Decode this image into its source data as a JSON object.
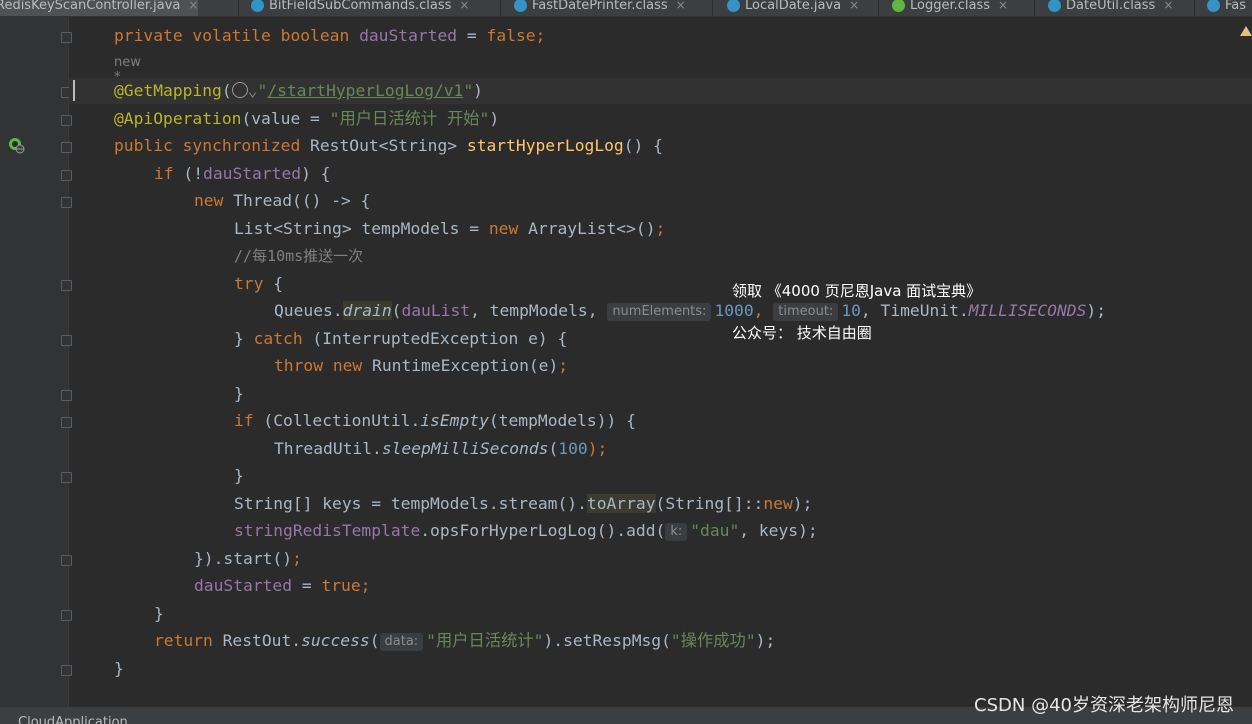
{
  "tabs": [
    {
      "label": "RedisKeyScanController.java",
      "active": true,
      "icon": "class-icon"
    },
    {
      "label": "BitFieldSubCommands.class",
      "active": false,
      "icon": "class-icon"
    },
    {
      "label": "FastDatePrinter.class",
      "active": false,
      "icon": "class-icon"
    },
    {
      "label": "LocalDate.java",
      "active": false,
      "icon": "class-icon"
    },
    {
      "label": "Logger.class",
      "active": false,
      "icon": "interface-icon"
    },
    {
      "label": "DateUtil.class",
      "active": false,
      "icon": "class-icon"
    },
    {
      "label": "Fas",
      "active": false,
      "icon": "class-icon"
    }
  ],
  "tab_close_glyph": "×",
  "new_tag": "new *",
  "code": {
    "l1": {
      "kw": "private volatile boolean",
      "field": "dauStarted",
      "rest": " = ",
      "val": "false",
      "end": ";"
    },
    "l2": {
      "ann": "@GetMapping",
      "open": "(",
      "chev": "⌄",
      "path_q1": "\"",
      "path": "/startHyperLogLog/v1",
      "path_q2": "\"",
      "close": ")"
    },
    "l3": {
      "ann": "@ApiOperation",
      "rest": "(value = ",
      "str": "\"用户日活统计 开始\"",
      "close": ")"
    },
    "l4": {
      "kw": "public synchronized",
      "type": " RestOut<String> ",
      "fn": "startHyperLogLog",
      "rest": "() {"
    },
    "l5": {
      "kw": "if",
      "rest": " (!",
      "field": "dauStarted",
      "end": ") {"
    },
    "l6": {
      "kw": "new",
      "rest": " Thread(() -> {"
    },
    "l7": {
      "pre": "List<String> tempModels = ",
      "kw": "new",
      "post": " ArrayList<>()",
      "end": ";"
    },
    "l8": {
      "comment": "//每10ms推送一次"
    },
    "l9": {
      "kw": "try",
      "rest": " {"
    },
    "l10": {
      "pre": "Queues.",
      "fn": "drain",
      "open": "(",
      "field": "dauList",
      "mid": ", tempModels, ",
      "hint1": "numElements:",
      "num1": "1000",
      "sep": ", ",
      "hint2": "timeout:",
      "num2": "10",
      "mid2": ", TimeUnit.",
      "const": "MILLISECONDS",
      "end": ");"
    },
    "l11": {
      "pre": "} ",
      "kw": "catch",
      "rest": " (InterruptedException e) {"
    },
    "l12": {
      "kw": "throw new",
      "rest": " RuntimeException(e)",
      "end": ";"
    },
    "l13": {
      "text": "}"
    },
    "l14": {
      "kw": "if",
      "pre": " (CollectionUtil.",
      "fn": "isEmpty",
      "rest": "(tempModels)) {"
    },
    "l15": {
      "pre": "ThreadUtil.",
      "fn": "sleepMilliSeconds",
      "open": "(",
      "num": "100",
      "end": ");"
    },
    "l16": {
      "text": "}"
    },
    "l17": {
      "pre": "String[] keys = tempModels.stream().",
      "fn": "toArray",
      "rest": "(String[]::",
      "kw": "new",
      "end": ");"
    },
    "l18": {
      "field": "stringRedisTemplate",
      "rest": ".opsForHyperLogLog().add(",
      "hint": "k:",
      "str": "\"dau\"",
      "end": ", keys);"
    },
    "l19": {
      "pre": "}).start()",
      "end": ";"
    },
    "l20": {
      "field": "dauStarted",
      "rest": " = ",
      "kw": "true",
      "end": ";"
    },
    "l21": {
      "text": "}"
    },
    "l22": {
      "kw": "return",
      "pre": " RestOut.",
      "fn": "success",
      "open": "(",
      "hint": "data:",
      "str": "\"用户日活统计\"",
      "mid": ").setRespMsg(",
      "str2": "\"操作成功\"",
      "end": ");"
    },
    "l23": {
      "text": "}"
    }
  },
  "overlay": {
    "line1": "领取 《4000 页尼恩Java 面试宝典》",
    "line2": "公众号： 技术自由圈"
  },
  "bottom_text": "CloudApplication ...",
  "watermark": "CSDN @40岁资深老架构师尼恩"
}
